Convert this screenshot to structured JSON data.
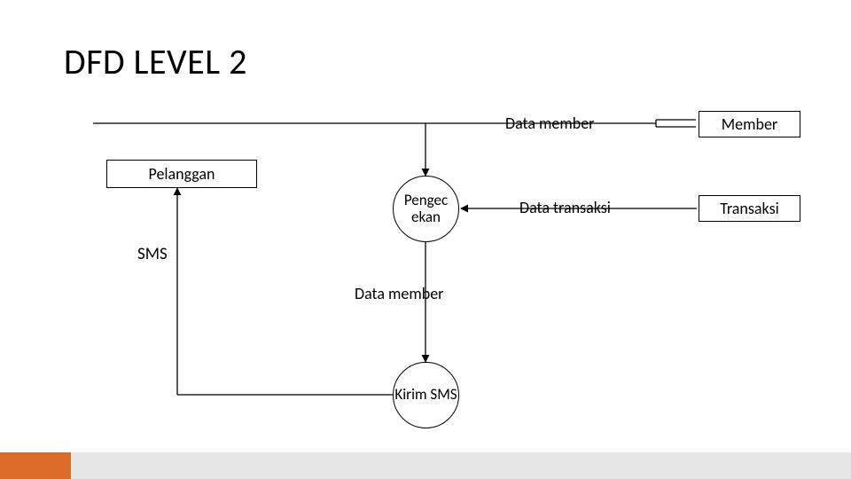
{
  "title": "DFD LEVEL 2",
  "entities": {
    "pelanggan": "Pelanggan",
    "member": "Member",
    "transaksi": "Transaksi"
  },
  "processes": {
    "pengecekan": "Pengec ekan",
    "kirim_sms": "Kirim SMS"
  },
  "flows": {
    "data_member_top": "Data member",
    "data_transaksi": "Data transaksi",
    "data_member_mid": "Data member",
    "sms": "SMS"
  }
}
